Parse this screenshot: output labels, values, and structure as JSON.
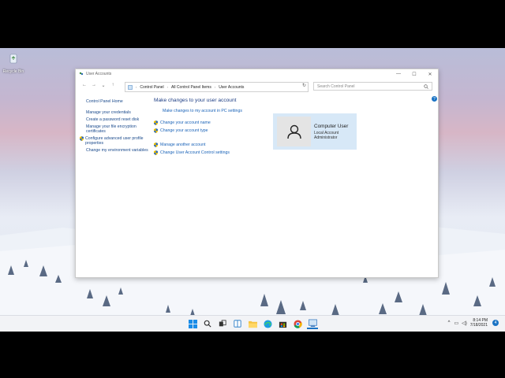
{
  "desktop": {
    "recycle_bin_label": "Recycle Bin"
  },
  "window": {
    "title": "User Accounts",
    "controls": {
      "minimize": "—",
      "maximize": "☐",
      "close": "✕"
    },
    "breadcrumb": [
      "Control Panel",
      "All Control Panel Items",
      "User Accounts"
    ],
    "search_placeholder": "Search Control Panel",
    "help_label": "?"
  },
  "sidebar": {
    "home": "Control Panel Home",
    "links": [
      "Manage your credentials",
      "Create a password reset disk",
      "Manage your file encryption certificates",
      "Configure advanced user profile properties",
      "Change my environment variables"
    ]
  },
  "main": {
    "heading": "Make changes to your user account",
    "pc_settings_link": "Make changes to my account in PC settings",
    "change_name": "Change your account name",
    "change_type": "Change your account type",
    "manage_another": "Manage another account",
    "uac_settings": "Change User Account Control settings"
  },
  "account": {
    "name": "Computer User",
    "type": "Local Account",
    "role": "Administrator"
  },
  "taskbar": {
    "icons": [
      "start-icon",
      "search-icon",
      "task-view-icon",
      "widgets-icon",
      "file-explorer-icon",
      "edge-icon",
      "store-icon",
      "chrome-icon",
      "control-panel-icon"
    ],
    "time": "8:14 PM",
    "date": "7/18/2021",
    "notification_count": "4"
  },
  "colors": {
    "accent": "#1a73c4",
    "link": "#1a63b8",
    "heading": "#1e3e84",
    "account_tile": "#d7e8f7"
  }
}
